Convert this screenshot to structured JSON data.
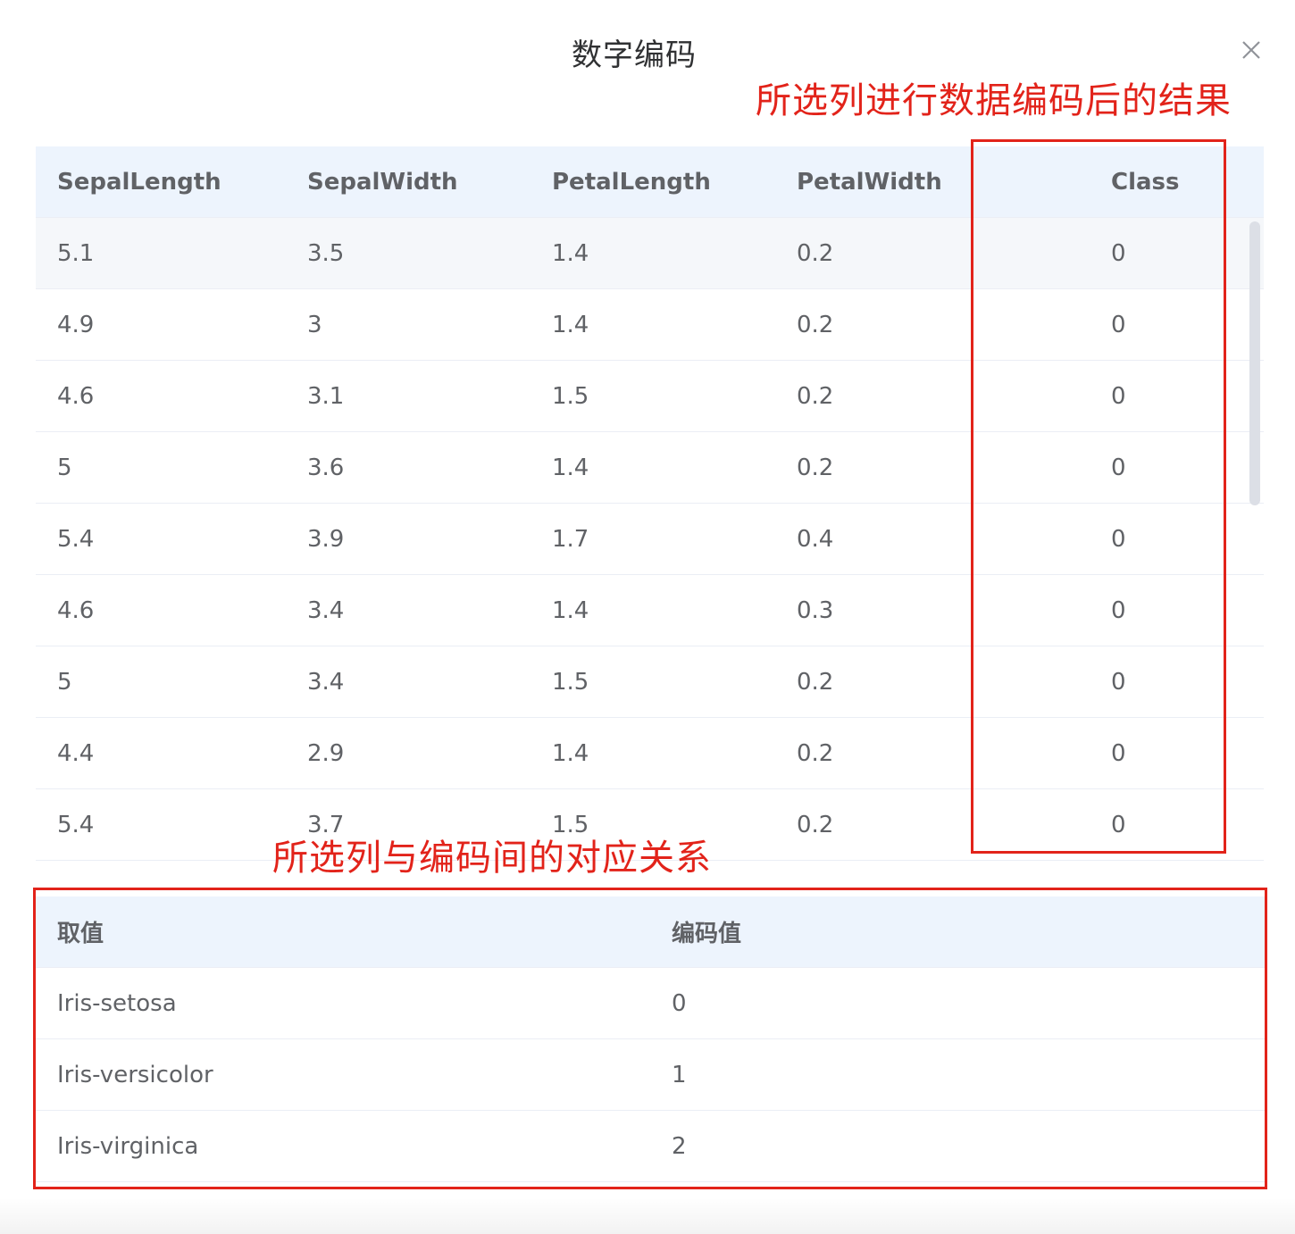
{
  "dialog": {
    "title": "数字编码",
    "close_icon": "close-icon"
  },
  "annotations": {
    "result_label": "所选列进行数据编码后的结果",
    "mapping_label": "所选列与编码间的对应关系",
    "color": "#e2231a"
  },
  "data_table": {
    "columns": [
      "SepalLength",
      "SepalWidth",
      "PetalLength",
      "PetalWidth",
      "Class"
    ],
    "rows": [
      [
        "5.1",
        "3.5",
        "1.4",
        "0.2",
        "0"
      ],
      [
        "4.9",
        "3",
        "1.4",
        "0.2",
        "0"
      ],
      [
        "4.6",
        "3.1",
        "1.5",
        "0.2",
        "0"
      ],
      [
        "5",
        "3.6",
        "1.4",
        "0.2",
        "0"
      ],
      [
        "5.4",
        "3.9",
        "1.7",
        "0.4",
        "0"
      ],
      [
        "4.6",
        "3.4",
        "1.4",
        "0.3",
        "0"
      ],
      [
        "5",
        "3.4",
        "1.5",
        "0.2",
        "0"
      ],
      [
        "4.4",
        "2.9",
        "1.4",
        "0.2",
        "0"
      ],
      [
        "5.4",
        "3.7",
        "1.5",
        "0.2",
        "0"
      ]
    ]
  },
  "mapping_table": {
    "columns": [
      "取值",
      "编码值"
    ],
    "rows": [
      [
        "Iris-setosa",
        "0"
      ],
      [
        "Iris-versicolor",
        "1"
      ],
      [
        "Iris-virginica",
        "2"
      ]
    ]
  },
  "colors": {
    "header_bg": "#edf4fd",
    "hover_row_bg": "#f5f7fa",
    "border": "#ebeef5",
    "text": "#606266"
  }
}
